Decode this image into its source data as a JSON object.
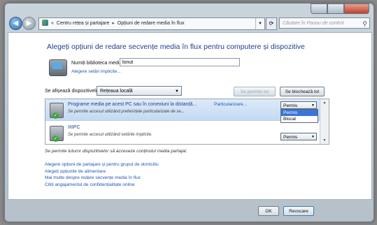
{
  "address_bar": {
    "back": "◀",
    "forward": "▶",
    "prefix": "«",
    "crumbs": [
      "Centru rețea și partajare",
      "Opțiuni de redare media în flux"
    ],
    "separator": "▸",
    "search_placeholder": "Căutare în Panou de control"
  },
  "main": {
    "heading": "Alegeți opțiuni de redare secvențe media în flux pentru computere și dispozitive",
    "library_label": "Numiți biblioteca media:",
    "library_value": "lonut",
    "library_link": "Alegere setări implicite...",
    "show_devices_label": "Se afișează dispozitivele din:",
    "show_devices_select": "Rețeaua locală",
    "allow_all_button": "Se permite tot",
    "block_all_button": "Se blochează tot"
  },
  "devices": [
    {
      "title": "Programe media pe acest PC sau în conexiuni la distanță...",
      "subtitle": "Se permite accesul utilizând preferințele particularizate de se...",
      "custom_link": "Particularizare...",
      "permission": "Permis"
    },
    {
      "title": "IIIIPC",
      "subtitle": "Se permite accesul utilizând setările implicite.",
      "permission": "Permis"
    }
  ],
  "dropdown_options": [
    "Permis",
    "Blocat"
  ],
  "dropdown_selected": "Permis",
  "note": "Se permite tuturor dispozitivelor să acceseze conținutul media partajat.",
  "links": [
    "Alegere opțiuni de partajare și pentru grupul de domiciliu",
    "Alegeți opțiunile de alimentare",
    "Mai multe despre redare secvențe media în flux",
    "Citiți angajamentul de confidențialitate online"
  ],
  "footer": {
    "ok": "OK",
    "cancel": "Revocare"
  }
}
